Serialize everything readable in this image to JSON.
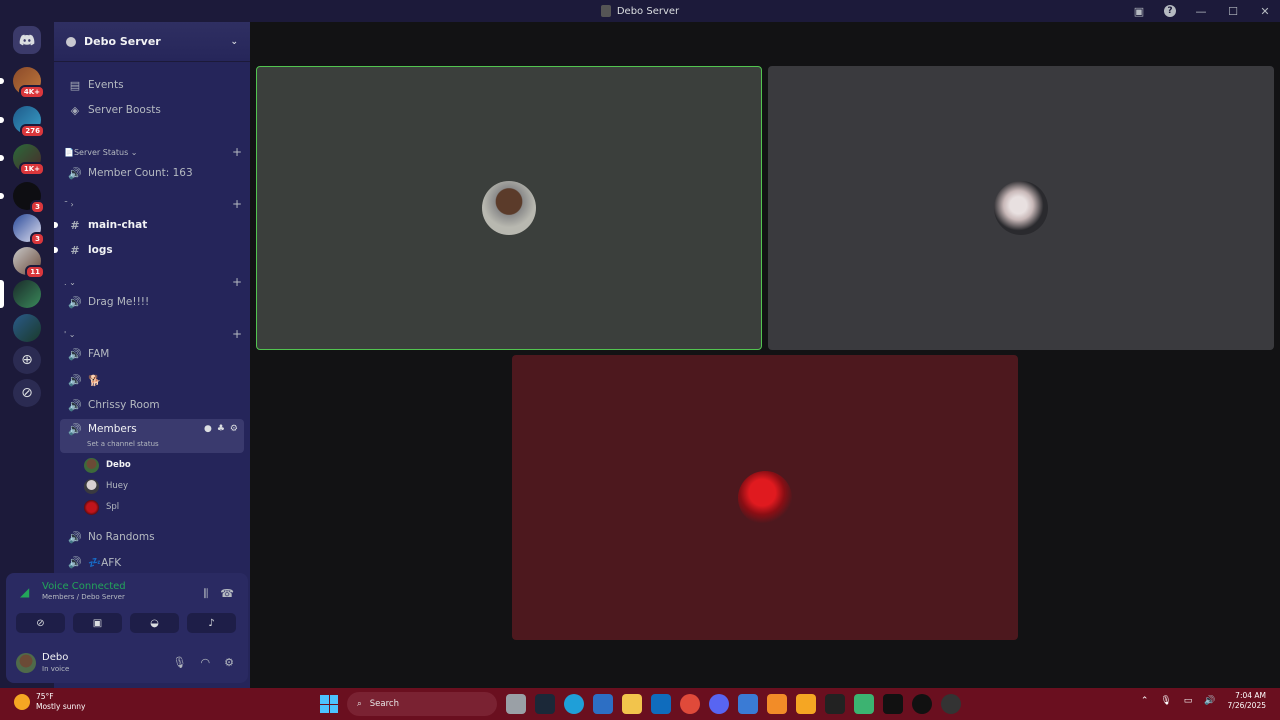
{
  "window": {
    "title": "Debo Server"
  },
  "server": {
    "name": "Debo Server"
  },
  "rail": {
    "badges": [
      "4K+",
      "276",
      "1K+",
      "3",
      "3",
      "11"
    ]
  },
  "sidebar": {
    "top_items": [
      {
        "label": "Events",
        "icon": "calendar-icon"
      },
      {
        "label": "Server Boosts",
        "icon": "boost-icon"
      }
    ],
    "categories": {
      "status": "📄Server Status ⌄",
      "cat2": "˜ ›",
      "cat3": ". ⌄",
      "cat4": "' ⌄"
    },
    "channels": {
      "member_count": "Member Count: 163",
      "main_chat": "main-chat",
      "logs": "logs",
      "drag_me": "Drag Me!!!!",
      "fam": "FAM",
      "dog": "🐕",
      "chrissy": "Chrissy Room",
      "members": "Members",
      "members_status": "Set a channel status",
      "no_randoms": "No Randoms",
      "afk": "💤AFK"
    },
    "voice_users": [
      "Debo",
      "Huey",
      "Spl"
    ]
  },
  "voice_panel": {
    "status": "Voice Connected",
    "location": "Members / Debo Server"
  },
  "user": {
    "name": "Debo",
    "status": "In voice"
  },
  "taskbar": {
    "weather_temp": "75°F",
    "weather_desc": "Mostly sunny",
    "search_placeholder": "Search",
    "time": "7:04 AM",
    "date": "7/26/2025"
  },
  "colors": {
    "accent_green": "#23a55a",
    "speaking_border": "#52c450",
    "sidebar_bg": "#25255a",
    "taskbar_bg": "#6a0f1f",
    "tile_red": "#4d181e"
  }
}
